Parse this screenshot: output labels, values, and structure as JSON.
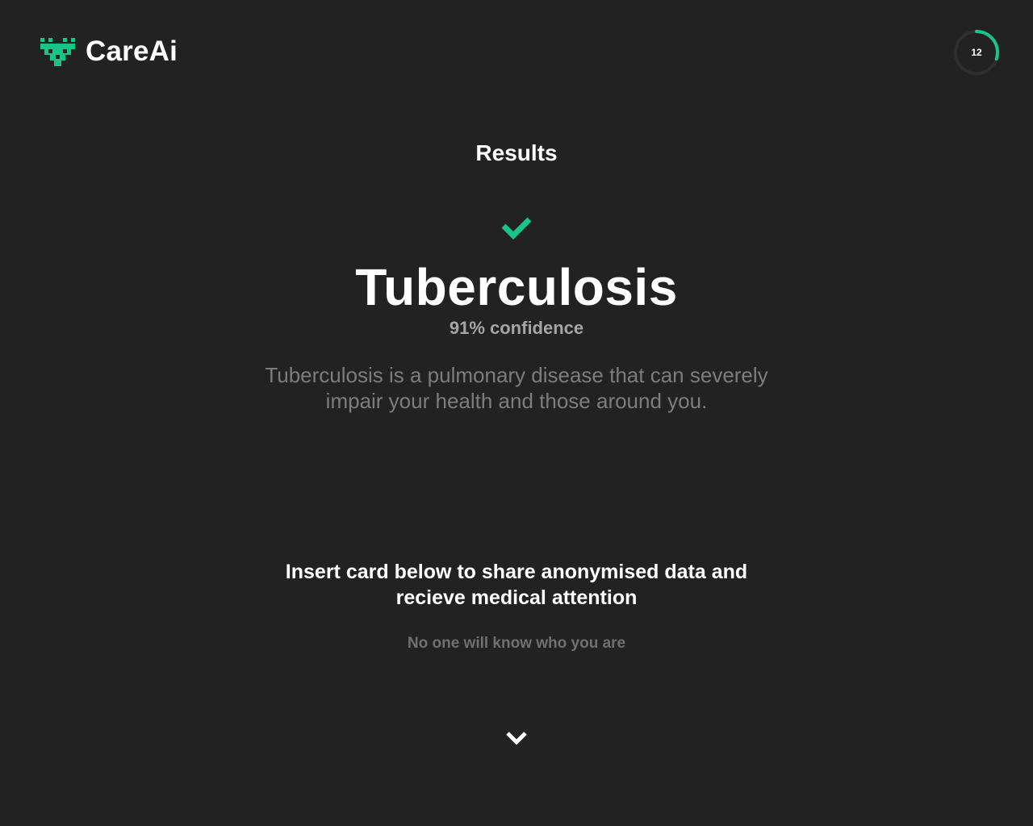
{
  "brand": {
    "name": "CareAi",
    "logo_icon": "pixel-heart-icon",
    "accent_color": "#19c489"
  },
  "timer": {
    "value": "12",
    "progress": 0.3
  },
  "results": {
    "heading": "Results",
    "status_icon": "checkmark-icon",
    "diagnosis": "Tuberculosis",
    "confidence": "91% confidence",
    "description": "Tuberculosis is a pulmonary disease that can severely impair your health and those around you."
  },
  "cta": {
    "title": "Insert card below to share anonymised data and recieve medical attention",
    "note": "No one will know who you are",
    "scroll_icon": "chevron-down-icon"
  },
  "colors": {
    "background": "#222222",
    "text": "#ffffff",
    "muted": "#7d7d7d"
  }
}
